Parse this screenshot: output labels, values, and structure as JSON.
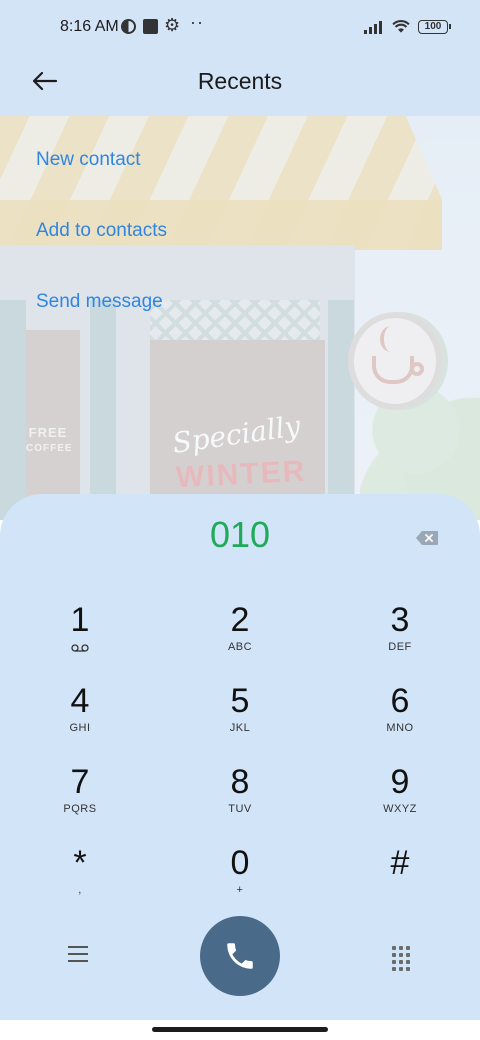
{
  "status_bar": {
    "time": "8:16 AM",
    "battery": "100",
    "icons": [
      "dnd-icon",
      "notification-square-icon",
      "settings-gear-icon",
      "more-dots-icon",
      "signal-icon",
      "wifi-icon",
      "battery-icon"
    ]
  },
  "header": {
    "title": "Recents",
    "back_icon": "arrow-left-icon"
  },
  "actions": [
    {
      "label": "New contact"
    },
    {
      "label": "Add to contacts"
    },
    {
      "label": "Send message"
    }
  ],
  "wallpaper": {
    "sign_text_1": "FREE",
    "sign_text_2": "COFFEE",
    "window_text_1": "Specially",
    "window_text_2": "WINTER"
  },
  "dialer": {
    "entered_number": "010",
    "number_color": "#1faa59",
    "keys": [
      {
        "digit": "1",
        "letters": ""
      },
      {
        "digit": "2",
        "letters": "ABC"
      },
      {
        "digit": "3",
        "letters": "DEF"
      },
      {
        "digit": "4",
        "letters": "GHI"
      },
      {
        "digit": "5",
        "letters": "JKL"
      },
      {
        "digit": "6",
        "letters": "MNO"
      },
      {
        "digit": "7",
        "letters": "PQRS"
      },
      {
        "digit": "8",
        "letters": "TUV"
      },
      {
        "digit": "9",
        "letters": "WXYZ"
      },
      {
        "digit": "*",
        "letters": ","
      },
      {
        "digit": "0",
        "letters": "+"
      },
      {
        "digit": "#",
        "letters": ""
      }
    ],
    "call_button_color": "#4a6a8a"
  },
  "colors": {
    "accent": "#2f86e2",
    "panel": "#d2e4f8",
    "header": "#d3e4f7"
  }
}
